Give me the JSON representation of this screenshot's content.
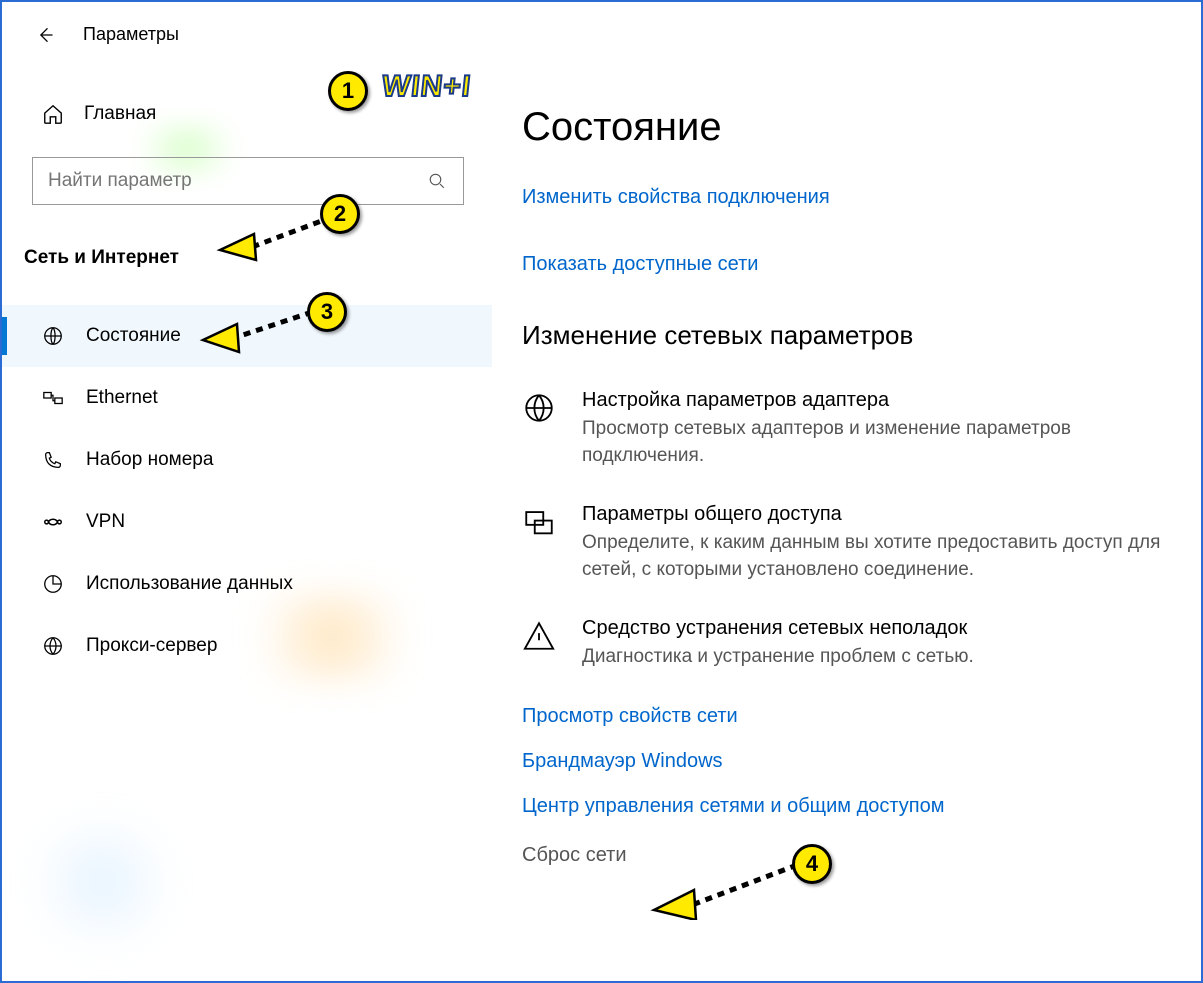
{
  "header": {
    "title": "Параметры"
  },
  "sidebar": {
    "home": "Главная",
    "search_placeholder": "Найти параметр",
    "category": "Сеть и Интернет",
    "items": [
      {
        "icon": "globe-icon",
        "label": "Состояние",
        "active": true
      },
      {
        "icon": "ethernet-icon",
        "label": "Ethernet"
      },
      {
        "icon": "phone-icon",
        "label": "Набор номера"
      },
      {
        "icon": "vpn-icon",
        "label": "VPN"
      },
      {
        "icon": "data-usage-icon",
        "label": "Использование данных"
      },
      {
        "icon": "proxy-icon",
        "label": "Прокси-сервер"
      }
    ]
  },
  "main": {
    "title": "Состояние",
    "link_change_props": "Изменить свойства подключения",
    "link_show_networks": "Показать доступные сети",
    "subheading": "Изменение сетевых параметров",
    "options": [
      {
        "title": "Настройка параметров адаптера",
        "desc": "Просмотр сетевых адаптеров и изменение параметров подключения."
      },
      {
        "title": "Параметры общего доступа",
        "desc": "Определите, к каким данным вы хотите предоставить доступ для сетей, с которыми установлено соединение."
      },
      {
        "title": "Средство устранения сетевых неполадок",
        "desc": "Диагностика и устранение проблем с сетью."
      }
    ],
    "link_view_props": "Просмотр свойств сети",
    "link_firewall": "Брандмауэр Windows",
    "link_sharing_center": "Центр управления сетями и общим доступом",
    "text_reset": "Сброс сети"
  },
  "annotations": {
    "b1": "1",
    "b2": "2",
    "b3": "3",
    "b4": "4",
    "win": "WIN+I"
  }
}
